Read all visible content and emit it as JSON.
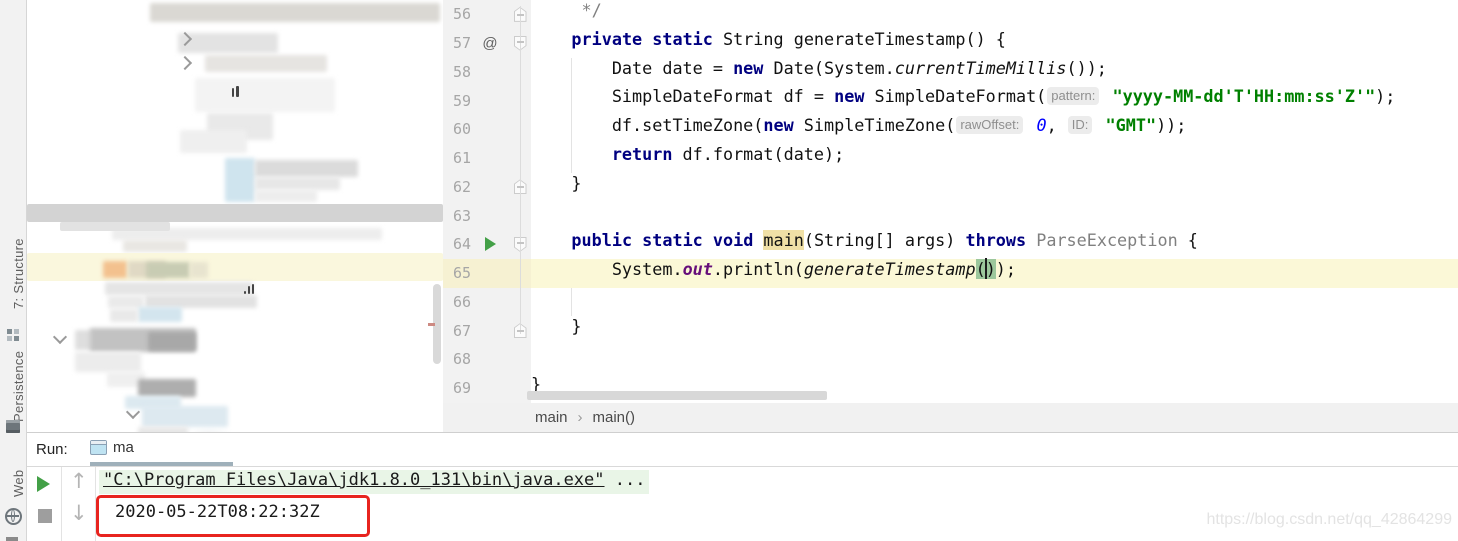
{
  "tool_stripe": {
    "items": [
      {
        "label": "7: Structure",
        "icon": "structure-icon"
      },
      {
        "label": "Persistence",
        "icon": "persistence-icon"
      },
      {
        "label": "Web",
        "icon": "globe-icon"
      }
    ]
  },
  "editor": {
    "lines": [
      {
        "num": "56",
        "fold": "up",
        "tokens": [
          {
            "t": "     */",
            "c": "c"
          }
        ]
      },
      {
        "num": "57",
        "icon": "at",
        "fold": "down",
        "tokens": [
          {
            "t": "    ",
            "c": "p"
          },
          {
            "t": "private",
            "c": "k"
          },
          {
            "t": " ",
            "c": "p"
          },
          {
            "t": "static",
            "c": "k"
          },
          {
            "t": " String generateTimestamp() {",
            "c": "p"
          }
        ]
      },
      {
        "num": "58",
        "tokens": [
          {
            "t": "        Date date = ",
            "c": "p"
          },
          {
            "t": "new",
            "c": "k"
          },
          {
            "t": " Date(System.",
            "c": "p"
          },
          {
            "t": "currentTimeMillis",
            "c": "im"
          },
          {
            "t": "());",
            "c": "p"
          }
        ]
      },
      {
        "num": "59",
        "tokens": [
          {
            "t": "        SimpleDateFormat df = ",
            "c": "p"
          },
          {
            "t": "new",
            "c": "k"
          },
          {
            "t": " SimpleDateFormat(",
            "c": "p"
          },
          {
            "t": "pattern:",
            "c": "hint"
          },
          {
            "t": " ",
            "c": "p"
          },
          {
            "t": "\"yyyy-MM-dd'T'HH:mm:ss'Z'\"",
            "c": "s"
          },
          {
            "t": ");",
            "c": "p"
          }
        ]
      },
      {
        "num": "60",
        "tokens": [
          {
            "t": "        df.setTimeZone(",
            "c": "p"
          },
          {
            "t": "new",
            "c": "k"
          },
          {
            "t": " SimpleTimeZone(",
            "c": "p"
          },
          {
            "t": "rawOffset:",
            "c": "hint"
          },
          {
            "t": " ",
            "c": "p"
          },
          {
            "t": "0",
            "c": "n"
          },
          {
            "t": ", ",
            "c": "p"
          },
          {
            "t": "ID:",
            "c": "hint"
          },
          {
            "t": " ",
            "c": "p"
          },
          {
            "t": "\"GMT\"",
            "c": "s"
          },
          {
            "t": "));",
            "c": "p"
          }
        ]
      },
      {
        "num": "61",
        "tokens": [
          {
            "t": "        ",
            "c": "p"
          },
          {
            "t": "return",
            "c": "k"
          },
          {
            "t": " df.format(date);",
            "c": "p"
          }
        ]
      },
      {
        "num": "62",
        "fold": "up",
        "tokens": [
          {
            "t": "    }",
            "c": "p"
          }
        ]
      },
      {
        "num": "63",
        "tokens": []
      },
      {
        "num": "64",
        "icon": "run",
        "fold": "down",
        "tokens": [
          {
            "t": "    ",
            "c": "p"
          },
          {
            "t": "public",
            "c": "k"
          },
          {
            "t": " ",
            "c": "p"
          },
          {
            "t": "static",
            "c": "k"
          },
          {
            "t": " ",
            "c": "p"
          },
          {
            "t": "void",
            "c": "k"
          },
          {
            "t": " ",
            "c": "p"
          },
          {
            "t": "main",
            "c": "mh"
          },
          {
            "t": "(String[] args) ",
            "c": "p"
          },
          {
            "t": "throws",
            "c": "k"
          },
          {
            "t": " ",
            "c": "p"
          },
          {
            "t": "ParseException",
            "c": "g"
          },
          {
            "t": " {",
            "c": "p"
          }
        ]
      },
      {
        "num": "65",
        "current": true,
        "tokens": [
          {
            "t": "        System.",
            "c": "p"
          },
          {
            "t": "out",
            "c": "sf"
          },
          {
            "t": ".println(",
            "c": "p"
          },
          {
            "t": "generateTimestamp",
            "c": "im"
          },
          {
            "t": "(",
            "c": "bh"
          },
          {
            "t": "",
            "c": "caret"
          },
          {
            "t": ")",
            "c": "bh"
          },
          {
            "t": ");",
            "c": "p"
          }
        ]
      },
      {
        "num": "66",
        "tokens": []
      },
      {
        "num": "67",
        "fold": "up",
        "tokens": [
          {
            "t": "    }",
            "c": "p"
          }
        ]
      },
      {
        "num": "68",
        "tokens": []
      },
      {
        "num": "69",
        "tokens": [
          {
            "t": "}",
            "c": "p"
          }
        ]
      }
    ],
    "breadcrumbs": {
      "items": [
        "main",
        "main()"
      ],
      "separator": "›"
    }
  },
  "run_panel": {
    "label": "Run:",
    "tab": {
      "label": "ma"
    },
    "console": {
      "line1": {
        "link": "\"C:\\Program Files\\Java\\jdk1.8.0_131\\bin\\java.exe\"",
        "rest": " ..."
      },
      "line2": {
        "text": "2020-05-22T08:22:32Z"
      }
    }
  },
  "watermark": "https://blog.csdn.net/qq_42864299",
  "colors": {
    "keyword": "#000080",
    "string": "#008000",
    "number": "#0000ff",
    "current_line": "#fbf8d7",
    "usage_highlight": "#f0e0a6",
    "brace_match": "#9cc79c",
    "run_green": "#43a047",
    "red_annotation_box": "#e8241f",
    "console_command_bg": "#e9f5e7",
    "tab_underline": "#9fb0ba"
  }
}
